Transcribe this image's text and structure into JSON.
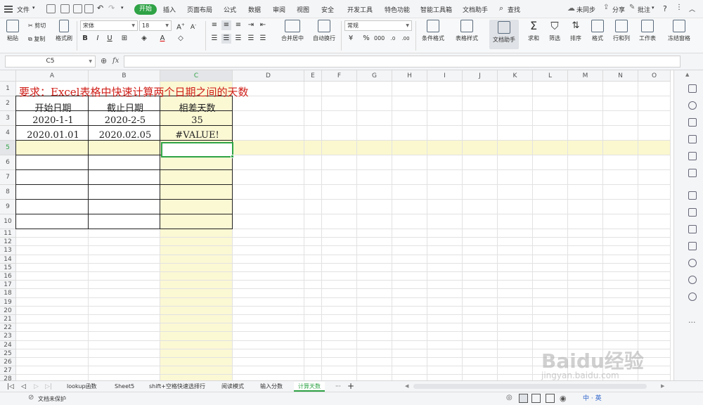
{
  "menu": {
    "file": "文件",
    "tabs": [
      "开始",
      "插入",
      "页面布局",
      "公式",
      "数据",
      "审阅",
      "视图",
      "安全",
      "开发工具",
      "特色功能",
      "智能工具箱",
      "文档助手"
    ],
    "search": "查找",
    "sync": "未同步",
    "share": "分享",
    "comment": "批注",
    "help": "?"
  },
  "ribbon": {
    "paste": "粘贴",
    "cut": "剪切",
    "copy": "复制",
    "format_painter": "格式刷",
    "font": "宋体",
    "size": "18",
    "merge": "合并居中",
    "wrap": "自动换行",
    "number_format": "常规",
    "cond_format": "条件格式",
    "table_style": "表格样式",
    "doc_helper": "文档助手",
    "sum": "求和",
    "filter": "筛选",
    "sort": "排序",
    "format": "格式",
    "rowcol": "行和列",
    "sheet": "工作表",
    "freeze": "冻结窗格",
    "percent": "%"
  },
  "formula_bar": {
    "name_box": "C5",
    "fx": "fx",
    "value": ""
  },
  "columns": [
    "A",
    "B",
    "C",
    "D",
    "E",
    "F",
    "G",
    "H",
    "I",
    "J",
    "K",
    "L",
    "M",
    "N",
    "O"
  ],
  "rows": [
    "1",
    "2",
    "3",
    "4",
    "5",
    "6",
    "7",
    "8",
    "9",
    "10",
    "11",
    "12",
    "13",
    "14",
    "15",
    "16",
    "17",
    "18",
    "19",
    "20",
    "21",
    "22",
    "23",
    "24",
    "25",
    "26",
    "27",
    "28"
  ],
  "sheet_cells": {
    "title": "要求：Excel表格中快速计算两个日期之间的天数",
    "header": [
      "开始日期",
      "截止日期",
      "相差天数"
    ],
    "row3": [
      "2020-1-1",
      "2020-2-5",
      "35"
    ],
    "row4": [
      "2020.01.01",
      "2020.02.05",
      "#VALUE!"
    ]
  },
  "colors": {
    "accent": "#2fa346",
    "title_red": "#d0201a",
    "col_c_fill": "#fbf8d4",
    "row5_fill": "#fbf8d0"
  },
  "sheet_tabs": [
    "lookup函数",
    "Sheet5",
    "shift+空格快速选择行",
    "阅读模式",
    "输入分数",
    "计算天数"
  ],
  "active_tab": "计算天数",
  "tab_more": "···",
  "tab_add": "+",
  "status": {
    "protect": "文档未保护"
  },
  "watermark": {
    "line1": "Baidu经验",
    "line2": "jingyan.baidu.com"
  },
  "ime": [
    "中",
    "·",
    "英"
  ]
}
